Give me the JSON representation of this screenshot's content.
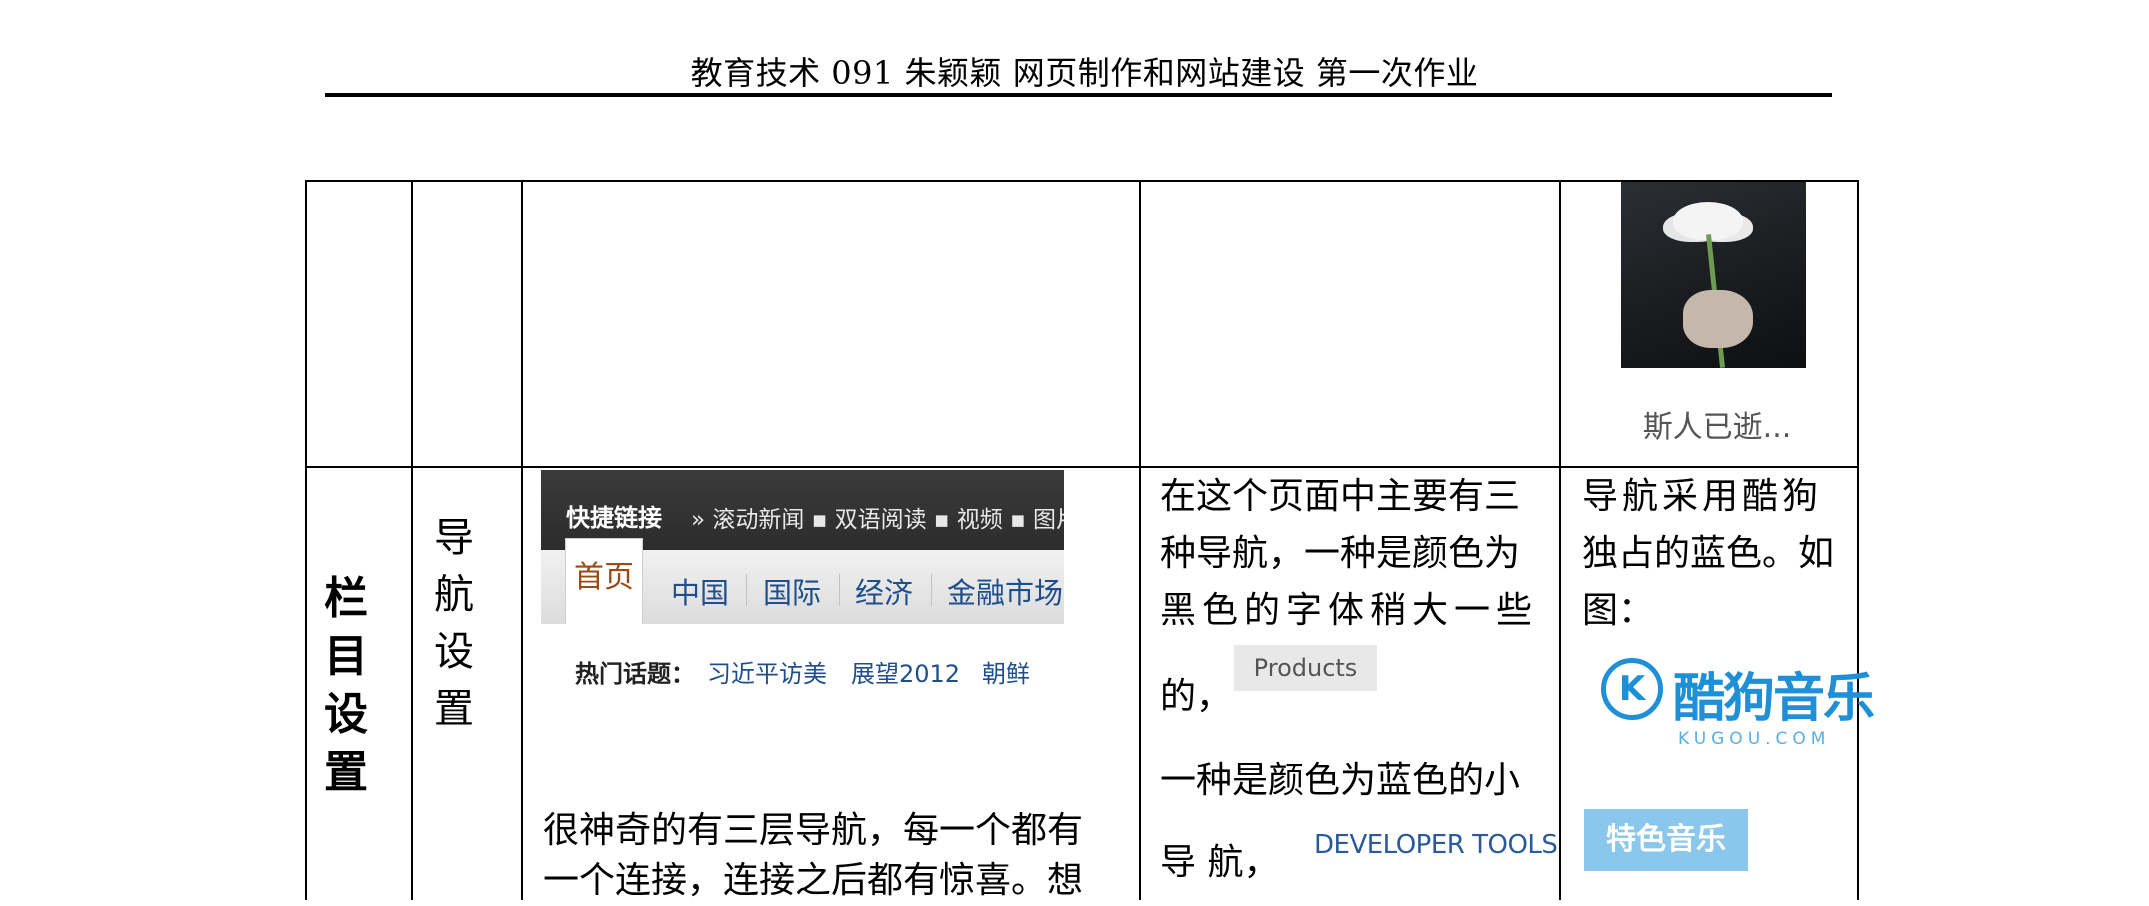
{
  "header": {
    "title": "教育技术 091 朱颖颖 网页制作和网站建设 第一次作业"
  },
  "row_top": {
    "photo_caption": "斯人已逝..."
  },
  "section": {
    "title_chars": [
      "栏",
      "目",
      "设",
      "置"
    ],
    "sub_chars": [
      "导",
      "航",
      "设",
      "置"
    ]
  },
  "nav_screenshot": {
    "quick_links_label": "快捷链接",
    "quick_links": "» 滚动新闻 ▪ 双语阅读 ▪ 视频 ▪ 图片报导",
    "tabs": [
      "首页",
      "中国",
      "国际",
      "经济",
      "金融市场"
    ],
    "hot_label": "热门话题：",
    "hot_items": [
      "习近平访美",
      "展望2012",
      "朝鲜"
    ]
  },
  "example_description": [
    "很神奇的有三层导航，每一个都有",
    "一个连接，连接之后都有惊喜。想"
  ],
  "analysis": {
    "lines": [
      "在这个页面中主要有三",
      "种导航，一种是颜色为",
      "黑色的字体稍大一些",
      "的，",
      "一种是颜色为蓝色的小",
      "导 航，"
    ],
    "products_label": "Products",
    "devtools_label": "DEVELOPER TOOLS"
  },
  "notes": {
    "lines": [
      "导航采用酷狗",
      "独占的蓝色。如",
      "图："
    ],
    "kugou_logo_letter": "K",
    "kugou_logo_cn": "酷狗音乐",
    "kugou_logo_en": "KUGOU.COM",
    "feature_button": "特色音乐"
  },
  "colors": {
    "kugou_blue": "#1f90d8",
    "nav_link_blue": "#1e4f8c",
    "home_tab_brown": "#9a4a14"
  }
}
